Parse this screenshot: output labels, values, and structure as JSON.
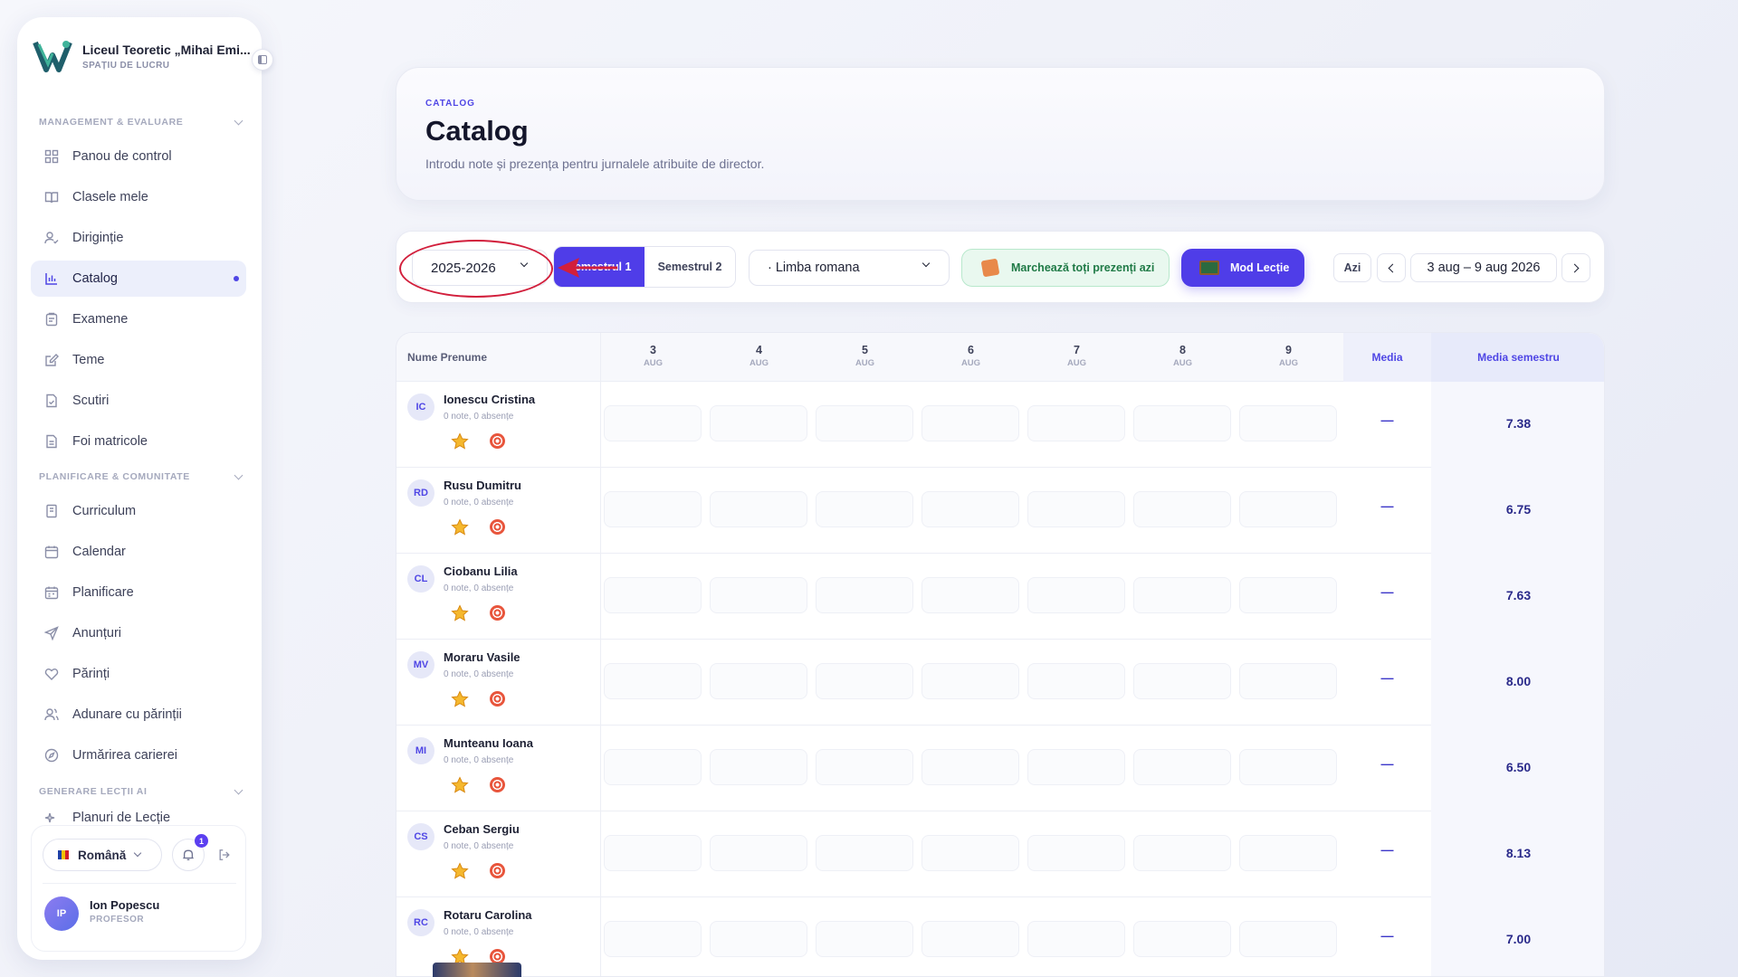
{
  "brand": {
    "name": "Liceul Teoretic „Mihai Emi...",
    "subtitle": "SPAȚIU DE LUCRU"
  },
  "sidebar": {
    "sections": [
      {
        "title": "MANAGEMENT & EVALUARE"
      },
      {
        "title": "PLANIFICARE & COMUNITATE"
      },
      {
        "title": "GENERARE LECȚII AI"
      }
    ],
    "items": [
      {
        "label": "Panou de control",
        "icon": "grid-icon"
      },
      {
        "label": "Clasele mele",
        "icon": "book-icon"
      },
      {
        "label": "Diriginție",
        "icon": "user-check-icon"
      },
      {
        "label": "Catalog",
        "icon": "bar-chart-icon",
        "active": true
      },
      {
        "label": "Examene",
        "icon": "clipboard-icon"
      },
      {
        "label": "Teme",
        "icon": "edit-icon"
      },
      {
        "label": "Scutiri",
        "icon": "file-check-icon"
      },
      {
        "label": "Foi matricole",
        "icon": "file-text-icon"
      },
      {
        "label": "Curriculum",
        "icon": "notebook-icon"
      },
      {
        "label": "Calendar",
        "icon": "calendar-icon"
      },
      {
        "label": "Planificare",
        "icon": "calendar-plan-icon"
      },
      {
        "label": "Anunțuri",
        "icon": "send-icon"
      },
      {
        "label": "Părinți",
        "icon": "heart-icon"
      },
      {
        "label": "Adunare cu părinții",
        "icon": "users-icon"
      },
      {
        "label": "Urmărirea carierei",
        "icon": "compass-icon"
      },
      {
        "label": "Planuri de Lecție",
        "icon": "sparkles-icon"
      }
    ],
    "language": "Română",
    "notifications_count": "1",
    "user": {
      "initials": "IP",
      "name": "Ion Popescu",
      "role": "PROFESOR"
    }
  },
  "header": {
    "eyebrow": "CATALOG",
    "title": "Catalog",
    "subtitle": "Introdu note și prezența pentru jurnalele atribuite de director."
  },
  "toolbar": {
    "year": "2025-2026",
    "semester_1": "Semestrul 1",
    "semester_2": "Semestrul 2",
    "subject": "· Limba romana",
    "mark_present": "Marchează toți prezenți azi",
    "lesson_mode": "Mod Lecție",
    "today": "Azi",
    "date_range": "3 aug – 9 aug 2026",
    "accent": "#4f3de8",
    "highlight_color": "#d21f3c"
  },
  "table": {
    "name_header": "Nume Prenume",
    "days": [
      {
        "day": "3",
        "month": "AUG"
      },
      {
        "day": "4",
        "month": "AUG"
      },
      {
        "day": "5",
        "month": "AUG"
      },
      {
        "day": "6",
        "month": "AUG"
      },
      {
        "day": "7",
        "month": "AUG"
      },
      {
        "day": "8",
        "month": "AUG"
      },
      {
        "day": "9",
        "month": "AUG"
      }
    ],
    "media_header": "Media",
    "media_sem_header": "Media semestru",
    "students": [
      {
        "initials": "IC",
        "name": "Ionescu Cristina",
        "meta": "0 note, 0 absențe",
        "media": "—",
        "media_sem": "7.38"
      },
      {
        "initials": "RD",
        "name": "Rusu Dumitru",
        "meta": "0 note, 0 absențe",
        "media": "—",
        "media_sem": "6.75"
      },
      {
        "initials": "CL",
        "name": "Ciobanu Lilia",
        "meta": "0 note, 0 absențe",
        "media": "—",
        "media_sem": "7.63"
      },
      {
        "initials": "MV",
        "name": "Moraru Vasile",
        "meta": "0 note, 0 absențe",
        "media": "—",
        "media_sem": "8.00"
      },
      {
        "initials": "MI",
        "name": "Munteanu Ioana",
        "meta": "0 note, 0 absențe",
        "media": "—",
        "media_sem": "6.50"
      },
      {
        "initials": "CS",
        "name": "Ceban Sergiu",
        "meta": "0 note, 0 absențe",
        "media": "—",
        "media_sem": "8.13"
      },
      {
        "initials": "RC",
        "name": "Rotaru Carolina",
        "meta": "0 note, 0 absențe",
        "media": "—",
        "media_sem": "7.00"
      }
    ]
  }
}
